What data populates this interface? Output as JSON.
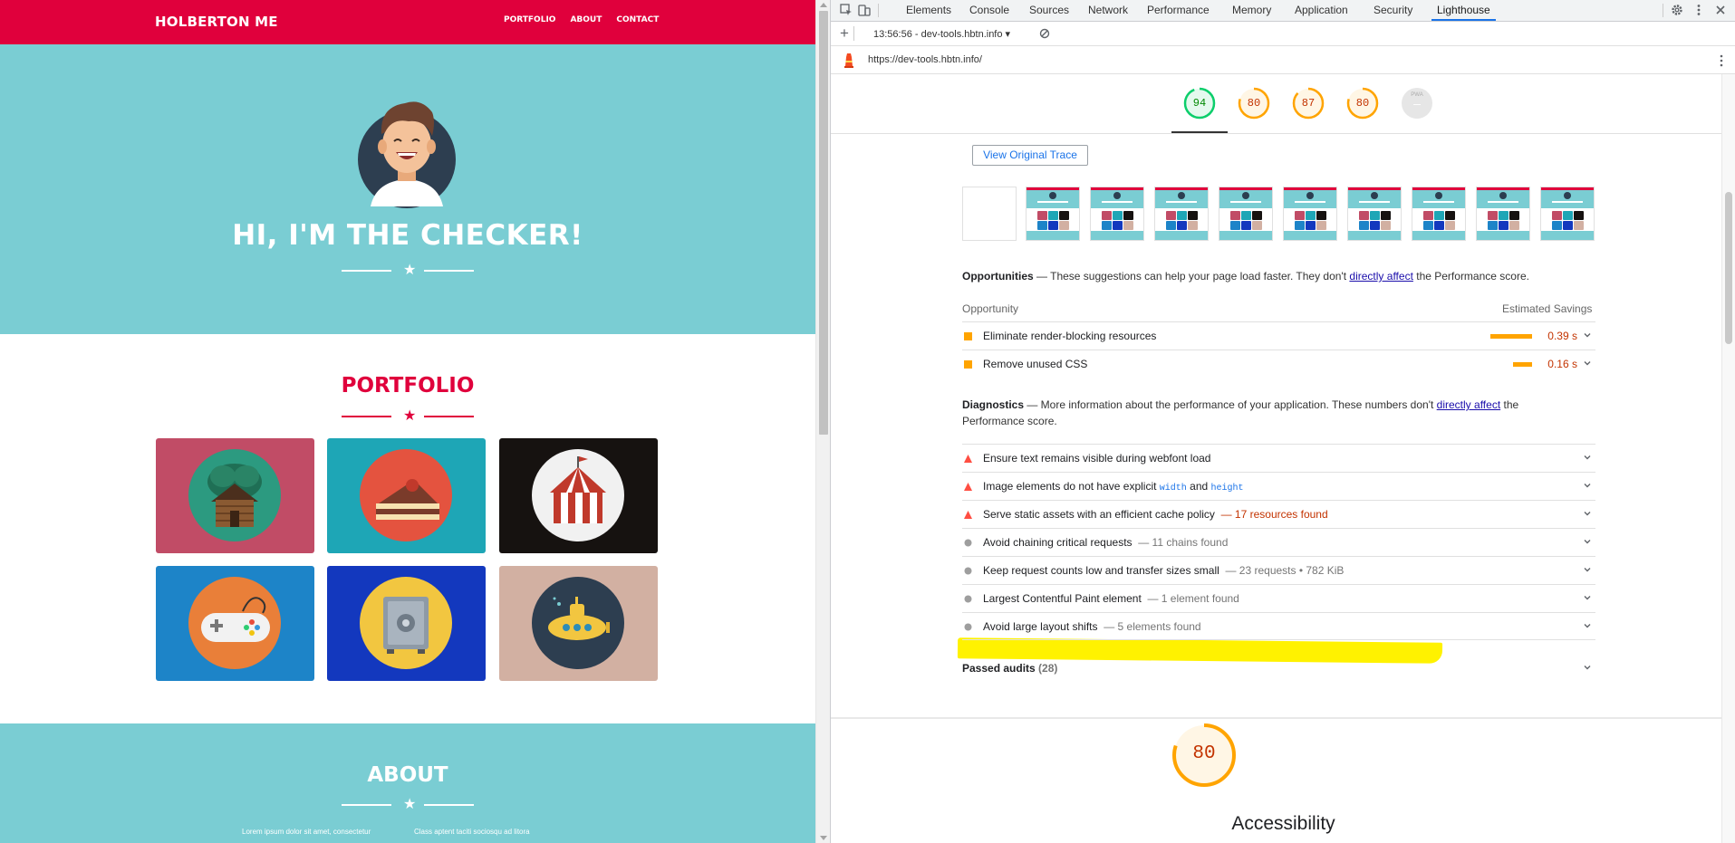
{
  "site": {
    "brand": "HOLBERTON ME",
    "nav": [
      "PORTFOLIO",
      "ABOUT",
      "CONTACT"
    ],
    "hero_title": "HI, I'M THE CHECKER!",
    "portfolio_title": "PORTFOLIO",
    "about_title": "ABOUT",
    "about_text_left": "Lorem ipsum dolor sit amet, consectetur",
    "about_text_right": "Class aptent taciti sociosqu ad litora",
    "tiles": [
      {
        "name": "cabin",
        "bg": "#c14c66",
        "circle": "#2c9a80"
      },
      {
        "name": "cake",
        "bg": "#1ea6b6",
        "circle": "#e4533f"
      },
      {
        "name": "circus",
        "bg": "#161210",
        "circle": "#f1f1f1"
      },
      {
        "name": "game-controller",
        "bg": "#1d84c8",
        "circle": "#e97f39"
      },
      {
        "name": "safe",
        "bg": "#1338be",
        "circle": "#f2c640"
      },
      {
        "name": "submarine",
        "bg": "#d2b0a2",
        "circle": "#2d3e50"
      }
    ],
    "colors": {
      "nav": "#e0003c",
      "hero": "#7acdd3",
      "accent": "#e0003c"
    }
  },
  "devtools": {
    "tabs": [
      "Elements",
      "Console",
      "Sources",
      "Network",
      "Performance",
      "Memory",
      "Application",
      "Security",
      "Lighthouse"
    ],
    "active_tab": "Lighthouse",
    "report_selector": "13:56:56 - dev-tools.hbtn.info",
    "url": "https://dev-tools.hbtn.info/",
    "gauges": [
      {
        "score": "94",
        "color": "#0cce6b"
      },
      {
        "score": "80",
        "color": "#ffa400"
      },
      {
        "score": "87",
        "color": "#ffa400"
      },
      {
        "score": "80",
        "color": "#ffa400"
      },
      {
        "score": "—",
        "label": "PWA",
        "color": "#cccccc"
      }
    ],
    "view_trace": "View Original Trace",
    "opportunities": {
      "title": "Opportunities",
      "desc_pre": " — These suggestions can help your page load faster. They don't ",
      "link": "directly affect",
      "desc_post": " the Performance score.",
      "col_left": "Opportunity",
      "col_right": "Estimated Savings",
      "items": [
        {
          "title": "Eliminate render-blocking resources",
          "savings": "0.39 s"
        },
        {
          "title": "Remove unused CSS",
          "savings": "0.16 s"
        }
      ]
    },
    "diagnostics": {
      "title": "Diagnostics",
      "desc_pre": " — More information about the performance of your application. These numbers don't ",
      "link": "directly affect",
      "desc_post": " the Performance score.",
      "items": [
        {
          "title": "Ensure text remains visible during webfont load",
          "display": "",
          "severity": "fail"
        },
        {
          "title": "Image elements do not have explicit",
          "code1": "width",
          "and": "and",
          "code2": "height",
          "display": "",
          "severity": "fail"
        },
        {
          "title": "Serve static assets with an efficient cache policy",
          "display": "— 17 resources found",
          "severity": "fail"
        },
        {
          "title": "Avoid chaining critical requests",
          "display": "— 11 chains found",
          "severity": "info"
        },
        {
          "title": "Keep request counts low and transfer sizes small",
          "display": "— 23 requests • 782 KiB",
          "severity": "info"
        },
        {
          "title": "Largest Contentful Paint element",
          "display": "— 1 element found",
          "severity": "info"
        },
        {
          "title": "Avoid large layout shifts",
          "display": "— 5 elements found",
          "severity": "info"
        }
      ]
    },
    "passed_audits": "Passed audits",
    "passed_count": "(28)",
    "accessibility_score": "80",
    "accessibility_title": "Accessibility"
  }
}
